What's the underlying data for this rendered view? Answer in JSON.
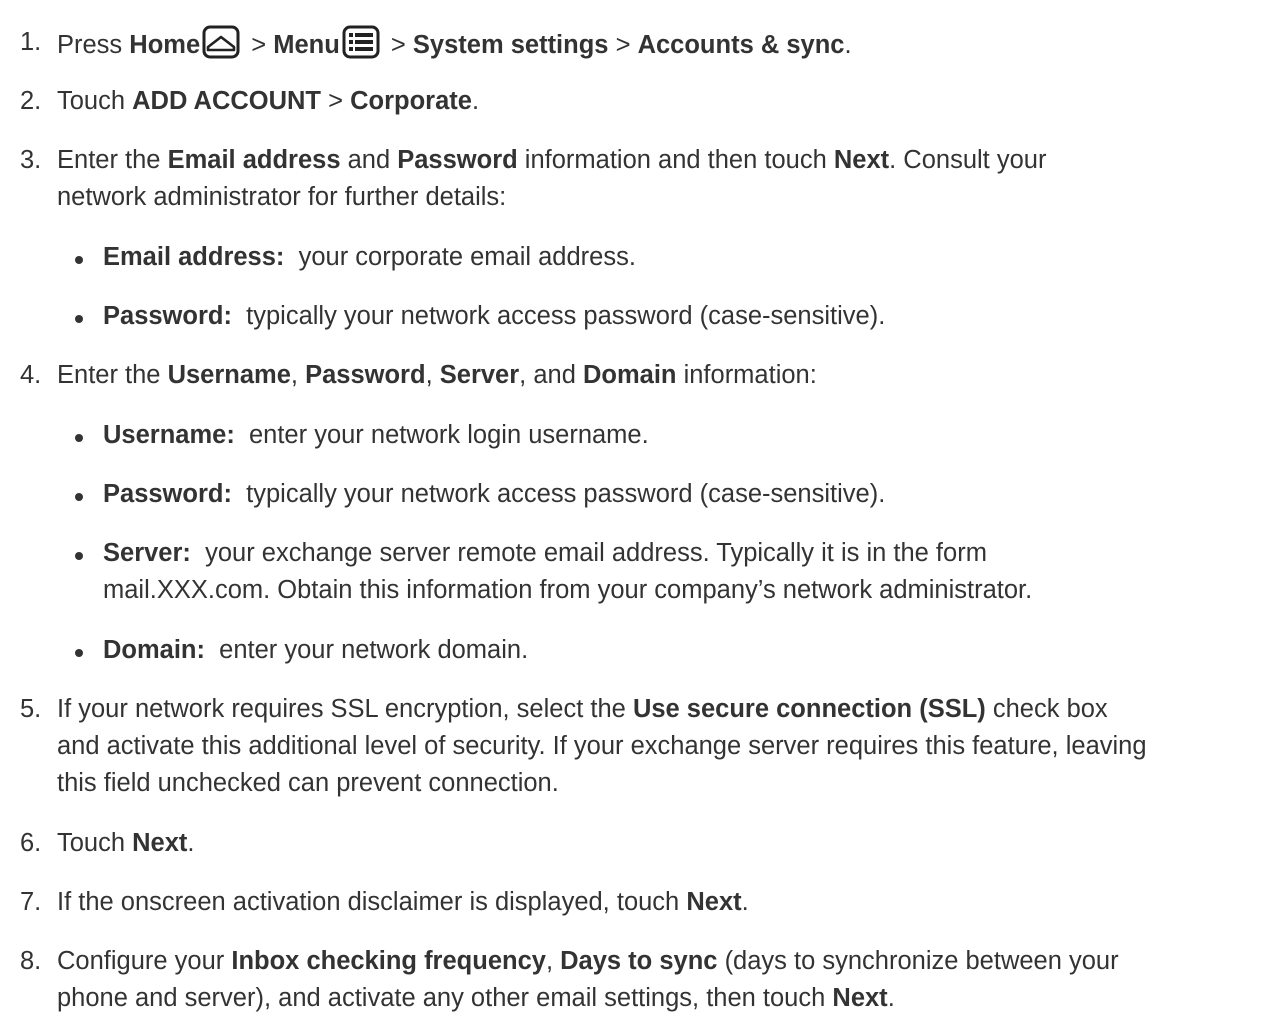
{
  "steps": [
    {
      "num": "1.",
      "press": "Press",
      "home": "Home",
      "sep1": ">",
      "menu": "Menu",
      "sep2": ">",
      "system_settings": "System settings",
      "sep3": ">",
      "accounts_sync": "Accounts & sync",
      "end": ".",
      "icons": [
        "home-icon",
        "menu-icon"
      ]
    },
    {
      "num": "2.",
      "touch": "Touch",
      "add_account": "ADD ACCOUNT",
      "sep": ">",
      "corporate": "Corporate",
      "end": "."
    },
    {
      "num": "3.",
      "enter": "Enter the",
      "email_address": "Email address",
      "and": "and",
      "password": "Password",
      "info": "information and then touch",
      "next": "Next",
      "consult": ". Consult your",
      "line2": "network administrator for further details:",
      "bullets": [
        {
          "label": "Email address:",
          "text": "your corporate email address."
        },
        {
          "label": "Password:",
          "text": "typically your network access password (case-sensitive)."
        }
      ]
    },
    {
      "num": "4.",
      "enter": "Enter the",
      "username": "Username",
      "comma1": ",",
      "password": "Password",
      "comma2": ",",
      "server": "Server",
      "and": ", and",
      "domain": "Domain",
      "info": "information:",
      "bullets": [
        {
          "label": "Username:",
          "text": "enter your network login username."
        },
        {
          "label": "Password:",
          "text": "typically your network access password (case-sensitive)."
        },
        {
          "label": "Server:",
          "text": "your exchange server remote email address. Typically it is in the form",
          "text2": "mail.XXX.com. Obtain this information from your company’s network administrator."
        },
        {
          "label": "Domain:",
          "text": "enter your network domain."
        }
      ]
    },
    {
      "num": "5.",
      "pre": "If your network requires SSL encryption, select the",
      "use_ssl": "Use secure connection (SSL)",
      "post": "check box",
      "line2": "and activate this additional level of security. If your exchange server requires this feature, leaving",
      "line3": "this field unchecked can prevent connection."
    },
    {
      "num": "6.",
      "touch": "Touch",
      "next": "Next",
      "end": "."
    },
    {
      "num": "7.",
      "pre": "If the onscreen activation disclaimer is displayed, touch",
      "next": "Next",
      "end": "."
    },
    {
      "num": "8.",
      "pre": "Configure your",
      "inbox": "Inbox checking frequency",
      "comma": ",",
      "days": "Days to sync",
      "mid": "(days to synchronize between your",
      "line2": "phone and server), and activate any other email settings, then touch",
      "next": "Next",
      "end": "."
    }
  ]
}
